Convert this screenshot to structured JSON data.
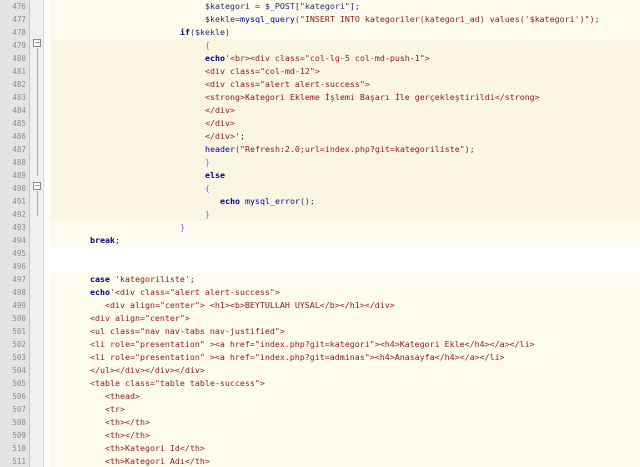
{
  "editor": {
    "lines": [
      {
        "num": "476",
        "indent": 31,
        "bg": "a",
        "tokens": [
          {
            "c": "var",
            "t": "$kategori = $_POST[\"kategori\"];"
          }
        ]
      },
      {
        "num": "477",
        "indent": 31,
        "bg": "a",
        "tokens": [
          {
            "c": "var",
            "t": "$kekle="
          },
          {
            "c": "fn",
            "t": "mysql_query"
          },
          {
            "c": "str",
            "t": "(\"INSERT INTO kategoriler(kategori_ad) values('$kategori')\")"
          },
          {
            "c": "var",
            "t": ";"
          }
        ]
      },
      {
        "num": "478",
        "indent": 26,
        "bg": "a",
        "tokens": [
          {
            "c": "kw",
            "t": "if"
          },
          {
            "c": "var",
            "t": "($kekle)"
          }
        ]
      },
      {
        "num": "479",
        "indent": 31,
        "bg": "b",
        "tokens": [
          {
            "c": "brace",
            "t": "{"
          }
        ]
      },
      {
        "num": "480",
        "indent": 31,
        "bg": "b",
        "tokens": [
          {
            "c": "kw",
            "t": "echo"
          },
          {
            "c": "str",
            "t": "'<br><div class=\"col-lg-5 col-md-push-1\">"
          }
        ]
      },
      {
        "num": "481",
        "indent": 31,
        "bg": "b",
        "tokens": [
          {
            "c": "str",
            "t": "<div class=\"col-md-12\">"
          }
        ]
      },
      {
        "num": "482",
        "indent": 31,
        "bg": "b",
        "tokens": [
          {
            "c": "str",
            "t": "<div class=\"alert alert-success\">"
          }
        ]
      },
      {
        "num": "483",
        "indent": 31,
        "bg": "b",
        "tokens": [
          {
            "c": "str",
            "t": "<strong>Kategori Ekleme İşlemi Başarı İle gerçekleştirildi</strong>"
          }
        ]
      },
      {
        "num": "484",
        "indent": 31,
        "bg": "b",
        "tokens": [
          {
            "c": "str",
            "t": "</div>"
          }
        ]
      },
      {
        "num": "485",
        "indent": 31,
        "bg": "b",
        "tokens": [
          {
            "c": "str",
            "t": "</div>"
          }
        ]
      },
      {
        "num": "486",
        "indent": 31,
        "bg": "b",
        "tokens": [
          {
            "c": "str",
            "t": "</div>'"
          },
          {
            "c": "var",
            "t": ";"
          }
        ]
      },
      {
        "num": "487",
        "indent": 31,
        "bg": "b",
        "tokens": [
          {
            "c": "fn",
            "t": "header"
          },
          {
            "c": "str",
            "t": "(\"Refresh:2.0;url=index.php?git=kategoriliste\")"
          },
          {
            "c": "var",
            "t": ";"
          }
        ]
      },
      {
        "num": "488",
        "indent": 31,
        "bg": "b",
        "tokens": [
          {
            "c": "brace",
            "t": "}"
          }
        ]
      },
      {
        "num": "489",
        "indent": 31,
        "bg": "b",
        "tokens": [
          {
            "c": "kw",
            "t": "else"
          }
        ]
      },
      {
        "num": "490",
        "indent": 31,
        "bg": "b",
        "tokens": [
          {
            "c": "brace",
            "t": "{"
          }
        ]
      },
      {
        "num": "491",
        "indent": 34,
        "bg": "b",
        "tokens": [
          {
            "c": "kw",
            "t": "echo "
          },
          {
            "c": "fn",
            "t": "mysql_error"
          },
          {
            "c": "var",
            "t": "();"
          }
        ]
      },
      {
        "num": "492",
        "indent": 31,
        "bg": "b",
        "tokens": [
          {
            "c": "brace",
            "t": "}"
          }
        ]
      },
      {
        "num": "493",
        "indent": 26,
        "bg": "a",
        "tokens": [
          {
            "c": "brace",
            "t": "}"
          }
        ]
      },
      {
        "num": "494",
        "indent": 8,
        "bg": "a",
        "tokens": [
          {
            "c": "kw",
            "t": "break"
          },
          {
            "c": "var",
            "t": ";"
          }
        ]
      },
      {
        "num": "495",
        "indent": 0,
        "bg": "a",
        "tokens": []
      },
      {
        "num": "496",
        "indent": 0,
        "bg": "a",
        "tokens": []
      },
      {
        "num": "497",
        "indent": 8,
        "bg": "a",
        "tokens": [
          {
            "c": "kw",
            "t": "case "
          },
          {
            "c": "str",
            "t": "'kategoriliste'"
          },
          {
            "c": "var",
            "t": ";"
          }
        ]
      },
      {
        "num": "498",
        "indent": 8,
        "bg": "a",
        "tokens": [
          {
            "c": "kw",
            "t": "echo"
          },
          {
            "c": "str",
            "t": "'<div class=\"alert alert-success\">"
          }
        ]
      },
      {
        "num": "499",
        "indent": 11,
        "bg": "a",
        "tokens": [
          {
            "c": "str",
            "t": "<div align=\"center\"> <h1><b>BEYTULLAH UYSAL</b></h1></div>"
          }
        ]
      },
      {
        "num": "500",
        "indent": 8,
        "bg": "a",
        "tokens": [
          {
            "c": "str",
            "t": "<div align=\"center\">"
          }
        ]
      },
      {
        "num": "501",
        "indent": 8,
        "bg": "a",
        "tokens": [
          {
            "c": "str",
            "t": "<ul class=\"nav nav-tabs nav-justified\">"
          }
        ]
      },
      {
        "num": "502",
        "indent": 8,
        "bg": "a",
        "tokens": [
          {
            "c": "str",
            "t": "<li role=\"presentation\" ><a href=\"index.php?git=kategori\"><h4>Kategori Ekle</h4></a></li>"
          }
        ]
      },
      {
        "num": "503",
        "indent": 8,
        "bg": "a",
        "tokens": [
          {
            "c": "str",
            "t": "<li role=\"presentation\" ><a href=\"index.php?git=adminas\"><h4>Anasayfa</h4></a></li>"
          }
        ]
      },
      {
        "num": "504",
        "indent": 8,
        "bg": "a",
        "tokens": [
          {
            "c": "str",
            "t": "</ul></div></div></div>"
          }
        ]
      },
      {
        "num": "505",
        "indent": 8,
        "bg": "a",
        "tokens": [
          {
            "c": "str",
            "t": "<table class=\"table table-success\">"
          }
        ]
      },
      {
        "num": "506",
        "indent": 11,
        "bg": "a",
        "tokens": [
          {
            "c": "str",
            "t": "<thead>"
          }
        ]
      },
      {
        "num": "507",
        "indent": 11,
        "bg": "a",
        "tokens": [
          {
            "c": "str",
            "t": "<tr>"
          }
        ]
      },
      {
        "num": "508",
        "indent": 11,
        "bg": "a",
        "tokens": [
          {
            "c": "str",
            "t": "<th></th>"
          }
        ]
      },
      {
        "num": "509",
        "indent": 11,
        "bg": "a",
        "tokens": [
          {
            "c": "str",
            "t": "<th></th>"
          }
        ]
      },
      {
        "num": "510",
        "indent": 11,
        "bg": "a",
        "tokens": [
          {
            "c": "str",
            "t": "<th>Kategori Id</th>"
          }
        ]
      },
      {
        "num": "511",
        "indent": 11,
        "bg": "a",
        "tokens": [
          {
            "c": "str",
            "t": "<th>Kategori Adı</th>"
          }
        ]
      }
    ]
  }
}
